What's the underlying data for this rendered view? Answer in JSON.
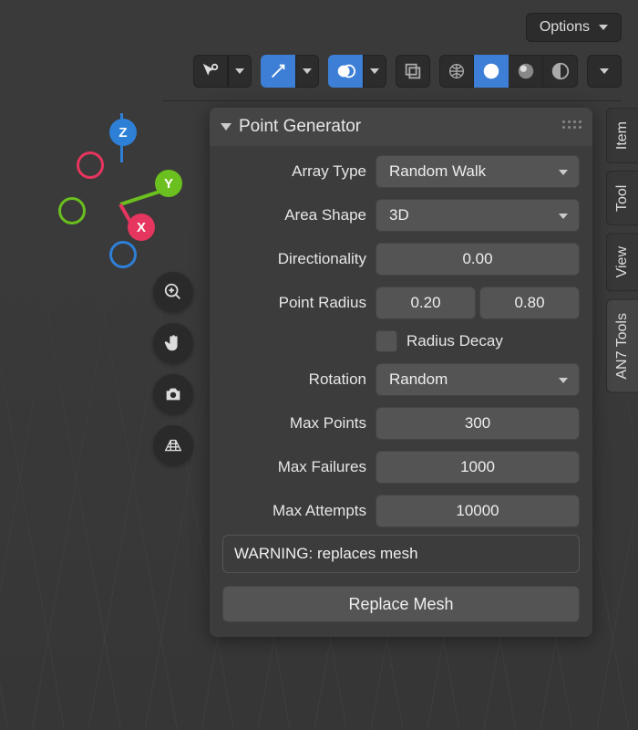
{
  "topbar": {
    "options_label": "Options"
  },
  "side_tabs": [
    "Item",
    "Tool",
    "View",
    "AN7 Tools"
  ],
  "gizmo": {
    "x": "X",
    "y": "Y",
    "z": "Z"
  },
  "panel": {
    "title": "Point Generator",
    "rows": {
      "array_type": {
        "label": "Array Type",
        "value": "Random Walk"
      },
      "area_shape": {
        "label": "Area Shape",
        "value": "3D"
      },
      "directionality": {
        "label": "Directionality",
        "value": "0.00"
      },
      "point_radius": {
        "label": "Point Radius",
        "min": "0.20",
        "max": "0.80"
      },
      "radius_decay": {
        "label": "Radius Decay",
        "checked": false
      },
      "rotation": {
        "label": "Rotation",
        "value": "Random"
      },
      "max_points": {
        "label": "Max Points",
        "value": "300"
      },
      "max_failures": {
        "label": "Max Failures",
        "value": "1000"
      },
      "max_attempts": {
        "label": "Max Attempts",
        "value": "10000"
      }
    },
    "warning": "WARNING: replaces mesh",
    "action": "Replace Mesh"
  },
  "colors": {
    "x": "#e6355e",
    "y": "#6bbf1f",
    "z": "#2e7fd6"
  }
}
